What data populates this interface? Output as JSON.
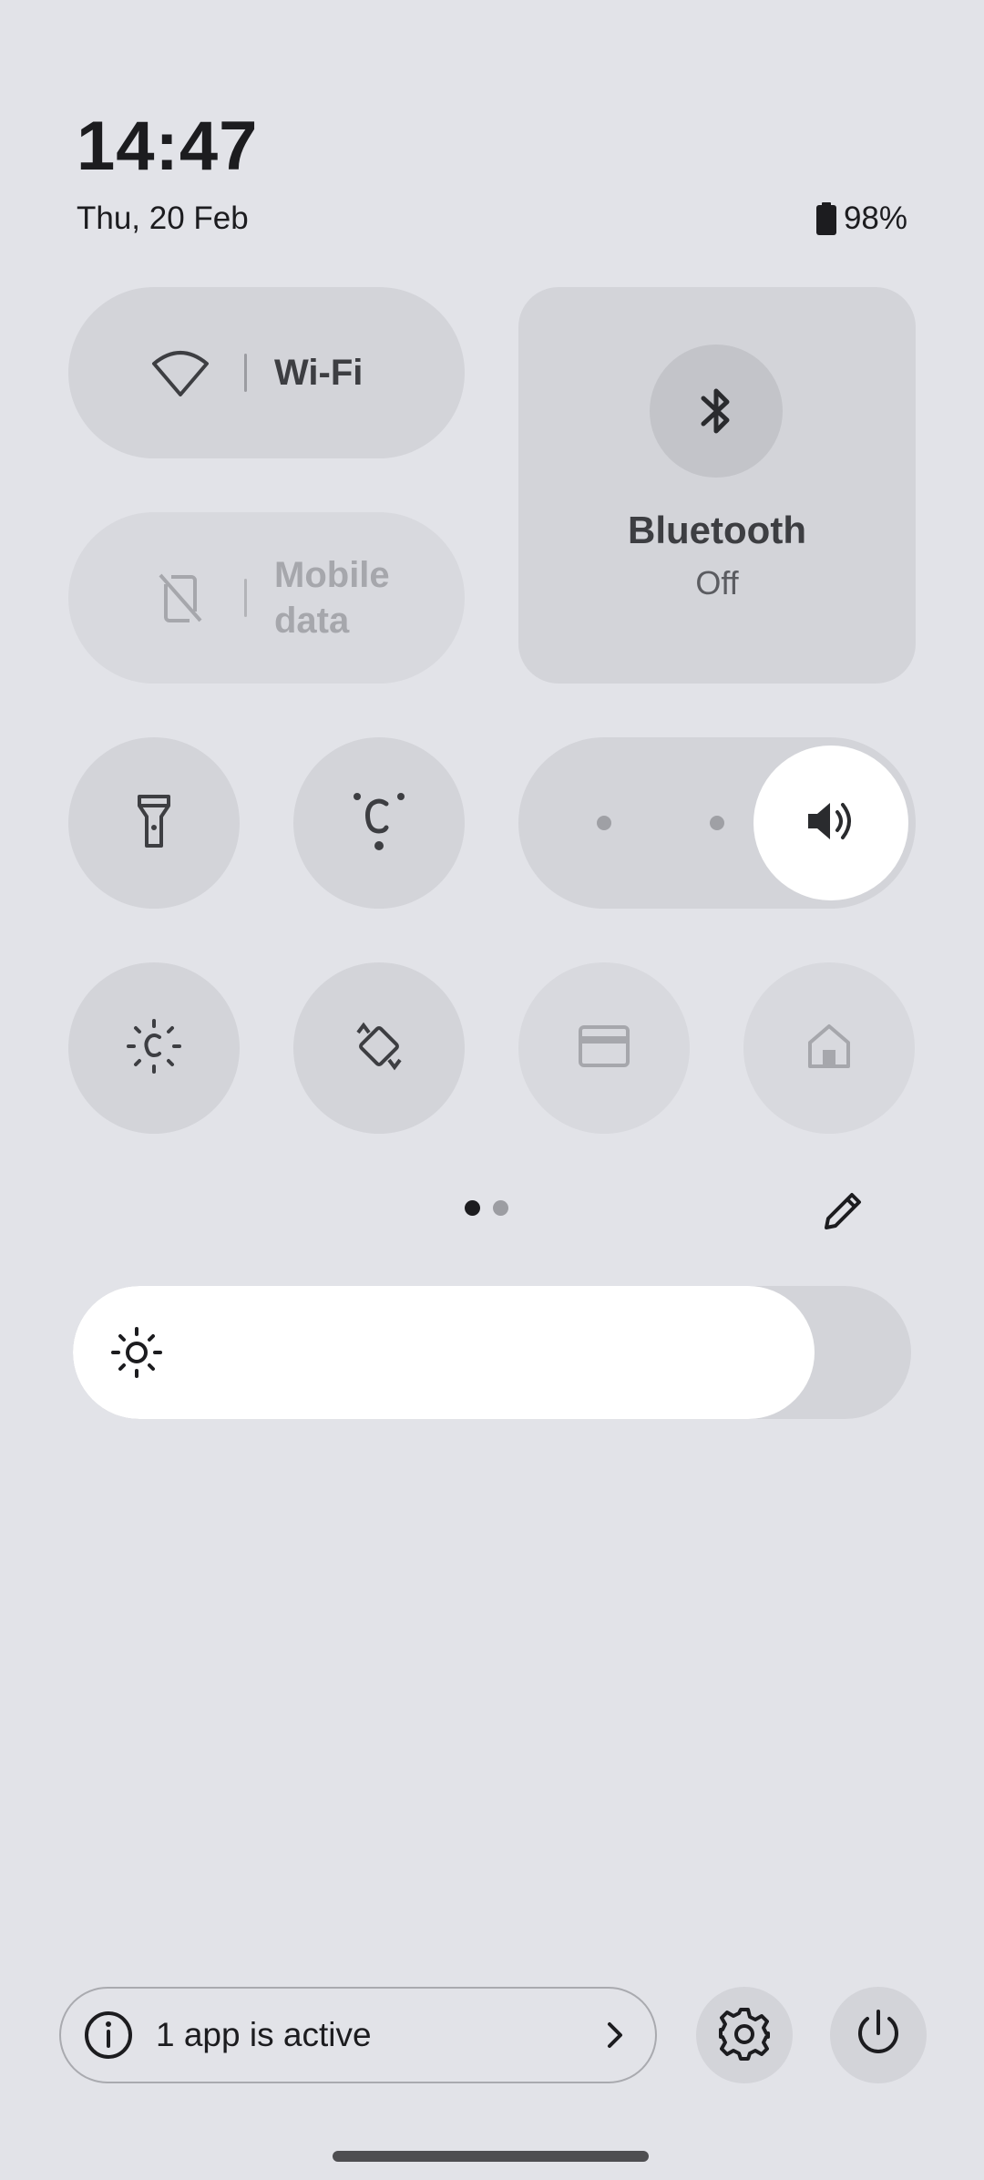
{
  "status": {
    "time": "14:47",
    "date": "Thu, 20 Feb",
    "battery_percent": "98%",
    "battery_icon": "battery-icon"
  },
  "tiles": {
    "wifi": {
      "label": "Wi-Fi",
      "icon": "wifi-icon",
      "active": false
    },
    "mobile_data": {
      "label_line1": "Mobile",
      "label_line2": "data",
      "icon": "no-sim-icon",
      "enabled": false
    },
    "bluetooth": {
      "label": "Bluetooth",
      "status": "Off",
      "icon": "bluetooth-icon"
    },
    "flashlight": {
      "icon": "flashlight-icon"
    },
    "hotspot": {
      "icon": "hotspot-icon"
    },
    "volume": {
      "icon": "volume-icon",
      "level": 1.0
    },
    "extra_dim": {
      "icon": "extra-dim-icon"
    },
    "auto_rotate": {
      "icon": "rotate-icon"
    },
    "wallet": {
      "icon": "wallet-icon",
      "enabled": false
    },
    "home": {
      "icon": "home-icon",
      "enabled": false
    }
  },
  "pager": {
    "pages": 2,
    "current": 1
  },
  "edit": {
    "icon": "pencil-icon"
  },
  "brightness": {
    "icon": "brightness-icon",
    "level": 0.885
  },
  "footer": {
    "active_apps_text": "1 app is active",
    "info_icon": "info-icon",
    "chevron_icon": "chevron-right-icon",
    "settings_icon": "gear-icon",
    "power_icon": "power-icon"
  },
  "colors": {
    "background": "#e2e3e8",
    "tile": "#d3d4d9",
    "tile_disabled": "#d8d9de",
    "accent_white": "#ffffff",
    "text_primary": "#1c1c1f"
  }
}
